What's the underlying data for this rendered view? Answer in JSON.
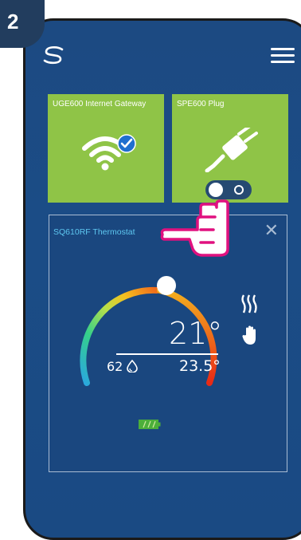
{
  "step_number": "2",
  "tiles": [
    {
      "label": "UGE600 Internet Gateway",
      "icon": "wifi-connected-icon"
    },
    {
      "label": "SPE600 Plug",
      "icon": "plug-icon"
    }
  ],
  "plug_toggle": {
    "state": "on"
  },
  "thermostat": {
    "title": "SQ610RF Thermostat",
    "current_temp": "21°",
    "humidity": "62",
    "setpoint": "23.5°",
    "mode_icons": [
      "heating-icon",
      "manual-hand-icon"
    ],
    "battery": "full"
  },
  "colors": {
    "accent_green": "#8fc447",
    "background_blue": "#1c4a82",
    "title_cyan": "#5ec7f0"
  }
}
